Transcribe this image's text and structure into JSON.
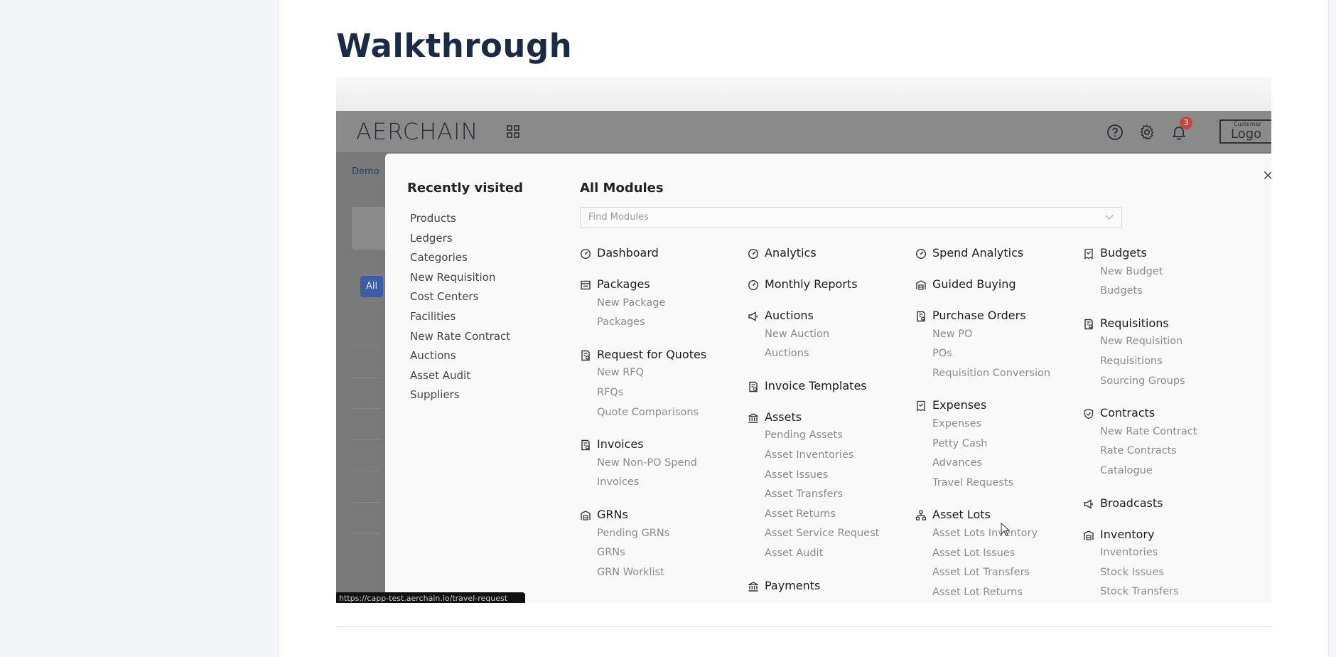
{
  "page": {
    "title": "Walkthrough"
  },
  "app": {
    "brand": "AERCHAIN",
    "notification_count": "3",
    "logo_sub": "Customer",
    "logo_main": "Logo",
    "breadcrumb": "Demo",
    "filter_all": "All",
    "status_url": "https://capp-test.aerchain.io/travel-request"
  },
  "modal": {
    "recent_title": "Recently visited",
    "recent_items": [
      "Products",
      "Ledgers",
      "Categories",
      "New Requisition",
      "Cost Centers",
      "Facilities",
      "New Rate Contract",
      "Auctions",
      "Asset Audit",
      "Suppliers"
    ],
    "modules_title": "All Modules",
    "search_placeholder": "Find Modules",
    "close_label": "×",
    "columns": [
      [
        {
          "label": "Dashboard",
          "icon": "gauge-icon",
          "items": []
        },
        {
          "label": "Packages",
          "icon": "package-icon",
          "items": [
            "New Package",
            "Packages"
          ]
        },
        {
          "label": "Request for Quotes",
          "icon": "document-icon",
          "items": [
            "New RFQ",
            "RFQs",
            "Quote Comparisons"
          ]
        },
        {
          "label": "Invoices",
          "icon": "document-icon",
          "items": [
            "New Non-PO Spend",
            "Invoices"
          ]
        },
        {
          "label": "GRNs",
          "icon": "warehouse-icon",
          "items": [
            "Pending GRNs",
            "GRNs",
            "GRN Worklist"
          ]
        }
      ],
      [
        {
          "label": "Analytics",
          "icon": "gauge-icon",
          "items": []
        },
        {
          "label": "Monthly Reports",
          "icon": "gauge-icon",
          "items": []
        },
        {
          "label": "Auctions",
          "icon": "megaphone-icon",
          "items": [
            "New Auction",
            "Auctions"
          ]
        },
        {
          "label": "Invoice Templates",
          "icon": "document-icon",
          "items": []
        },
        {
          "label": "Assets",
          "icon": "bank-icon",
          "items": [
            "Pending Assets",
            "Asset Inventories",
            "Asset Issues",
            "Asset Transfers",
            "Asset Returns",
            "Asset Service Request",
            "Asset Audit"
          ]
        },
        {
          "label": "Payments",
          "icon": "bank-icon",
          "items": []
        }
      ],
      [
        {
          "label": "Spend Analytics",
          "icon": "gauge-icon",
          "items": []
        },
        {
          "label": "Guided Buying",
          "icon": "warehouse-icon",
          "items": []
        },
        {
          "label": "Purchase Orders",
          "icon": "document-icon",
          "items": [
            "New PO",
            "POs",
            "Requisition Conversion"
          ]
        },
        {
          "label": "Expenses",
          "icon": "receipt-icon",
          "items": [
            "Expenses",
            "Petty Cash",
            "Advances",
            "Travel Requests"
          ]
        },
        {
          "label": "Asset Lots",
          "icon": "hierarchy-icon",
          "items": [
            "Asset Lots Inventory",
            "Asset Lot Issues",
            "Asset Lot Transfers",
            "Asset Lot Returns"
          ]
        }
      ],
      [
        {
          "label": "Budgets",
          "icon": "receipt-icon",
          "items": [
            "New Budget",
            "Budgets"
          ]
        },
        {
          "label": "Requisitions",
          "icon": "document-icon",
          "items": [
            "New Requisition",
            "Requisitions",
            "Sourcing Groups"
          ]
        },
        {
          "label": "Contracts",
          "icon": "shield-icon",
          "items": [
            "New Rate Contract",
            "Rate Contracts",
            "Catalogue"
          ]
        },
        {
          "label": "Broadcasts",
          "icon": "megaphone-icon",
          "items": []
        },
        {
          "label": "Inventory",
          "icon": "warehouse-icon",
          "items": [
            "Inventories",
            "Stock Issues",
            "Stock Transfers"
          ]
        }
      ]
    ]
  }
}
